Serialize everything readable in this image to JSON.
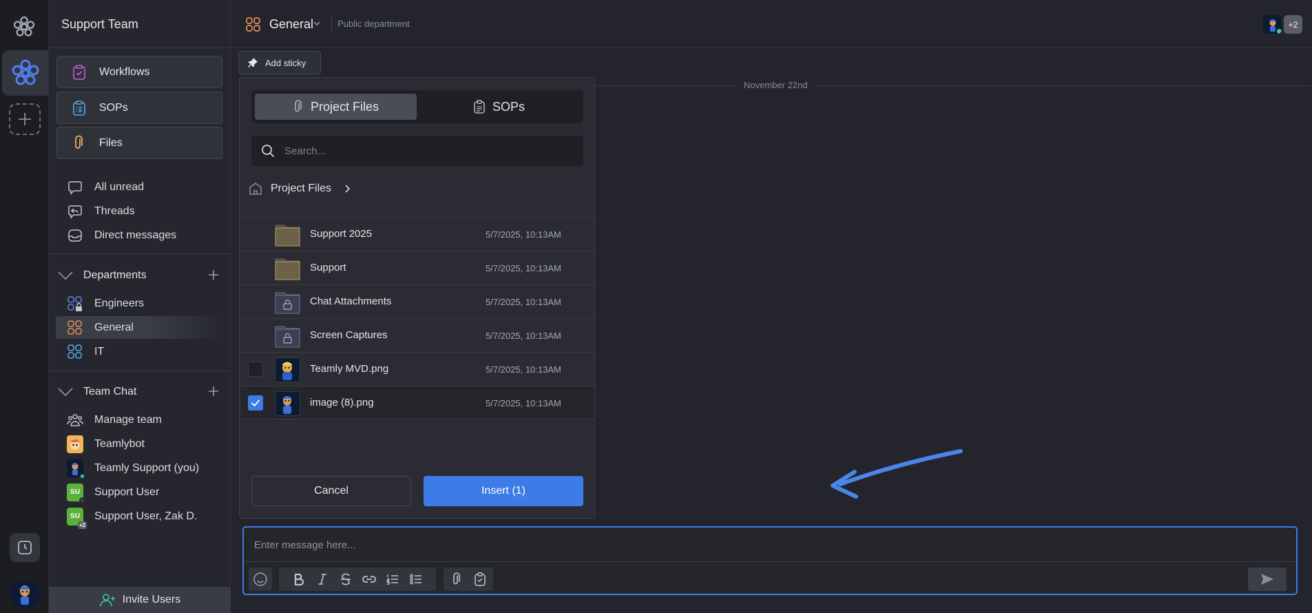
{
  "sidebar": {
    "team_name": "Support Team",
    "quick_buttons": [
      {
        "label": "Workflows",
        "icon": "clipboard-check-icon",
        "color": "#c660d8"
      },
      {
        "label": "SOPs",
        "icon": "clipboard-list-icon",
        "color": "#5aa7e6"
      },
      {
        "label": "Files",
        "icon": "paperclip-icon",
        "color": "#e8b95e"
      }
    ],
    "nav": [
      {
        "label": "All unread",
        "icon": "chat-bubble-icon"
      },
      {
        "label": "Threads",
        "icon": "threads-icon"
      },
      {
        "label": "Direct messages",
        "icon": "inbox-icon"
      }
    ],
    "departments": {
      "title": "Departments",
      "items": [
        {
          "label": "Engineers",
          "icon": "department-lock-icon",
          "color": "#5e7be6"
        },
        {
          "label": "General",
          "icon": "department-icon",
          "color": "#e58a5a",
          "active": true
        },
        {
          "label": "IT",
          "icon": "department-icon",
          "color": "#5aa7e6"
        }
      ]
    },
    "team_chat": {
      "title": "Team Chat",
      "items": [
        {
          "label": "Manage team",
          "icon": "people-icon"
        },
        {
          "label": "Teamlybot",
          "icon": "bot-avatar"
        },
        {
          "label": "Teamly Support (you)",
          "icon": "user-avatar"
        },
        {
          "label": "Support User",
          "initials": "SU"
        },
        {
          "label": "Support User, Zak D.",
          "initials": "SU",
          "badge": "+2"
        }
      ]
    },
    "invite_label": "Invite Users"
  },
  "header": {
    "channel_name": "General",
    "channel_desc": "Public department",
    "member_count": "+2"
  },
  "toolbar": {
    "sticky_label": "Add sticky"
  },
  "date_divider": "November 22nd",
  "files_panel": {
    "tabs": [
      {
        "label": "Project Files",
        "icon": "paperclip-icon",
        "active": true
      },
      {
        "label": "SOPs",
        "icon": "clipboard-list-icon",
        "active": false
      }
    ],
    "search_placeholder": "Search...",
    "breadcrumb": "Project Files",
    "files": [
      {
        "name": "Support 2025",
        "date": "5/7/2025, 10:13AM",
        "kind": "folder"
      },
      {
        "name": "Support",
        "date": "5/7/2025, 10:13AM",
        "kind": "folder"
      },
      {
        "name": "Chat Attachments",
        "date": "5/7/2025, 10:13AM",
        "kind": "locked-folder"
      },
      {
        "name": "Screen Captures",
        "date": "5/7/2025, 10:13AM",
        "kind": "locked-folder"
      },
      {
        "name": "Teamly MVD.png",
        "date": "5/7/2025, 10:13AM",
        "kind": "image",
        "checked": false
      },
      {
        "name": "image (8).png",
        "date": "5/7/2025, 10:13AM",
        "kind": "image",
        "checked": true
      }
    ],
    "cancel_label": "Cancel",
    "insert_label": "Insert (1)"
  },
  "composer": {
    "placeholder": "Enter message here..."
  },
  "colors": {
    "accent": "#3d7be6",
    "arrow": "#4a86ea",
    "online": "#3ec9a7"
  }
}
